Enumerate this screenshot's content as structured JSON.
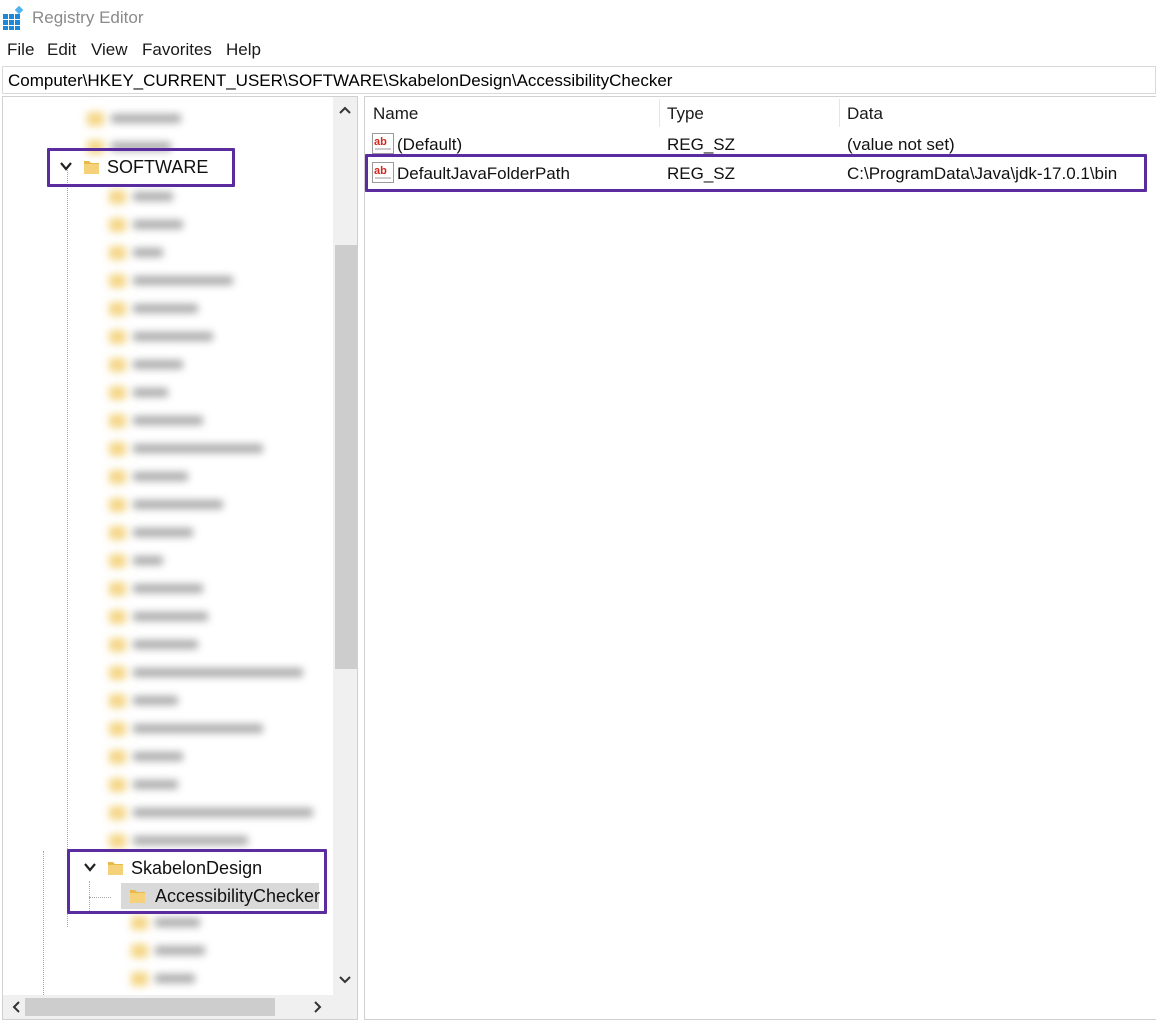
{
  "window": {
    "title": "Registry Editor",
    "icon": "registry-editor-icon"
  },
  "menu": [
    "File",
    "Edit",
    "View",
    "Favorites",
    "Help"
  ],
  "address": "Computer\\HKEY_CURRENT_USER\\SOFTWARE\\SkabelonDesign\\AccessibilityChecker",
  "tree": {
    "software_label": "SOFTWARE",
    "skabelon_label": "SkabelonDesign",
    "accessibility_label": "AccessibilityChecker"
  },
  "columns": {
    "name": "Name",
    "type": "Type",
    "data": "Data"
  },
  "values": [
    {
      "name": "(Default)",
      "type": "REG_SZ",
      "data": "(value not set)",
      "icon": "string-value-icon"
    },
    {
      "name": "DefaultJavaFolderPath",
      "type": "REG_SZ",
      "data": "C:\\ProgramData\\Java\\jdk-17.0.1\\bin",
      "icon": "string-value-icon"
    }
  ],
  "colors": {
    "highlight": "#5b2ca0",
    "folder": "#f1c95f",
    "selection": "#d9d9d9"
  }
}
